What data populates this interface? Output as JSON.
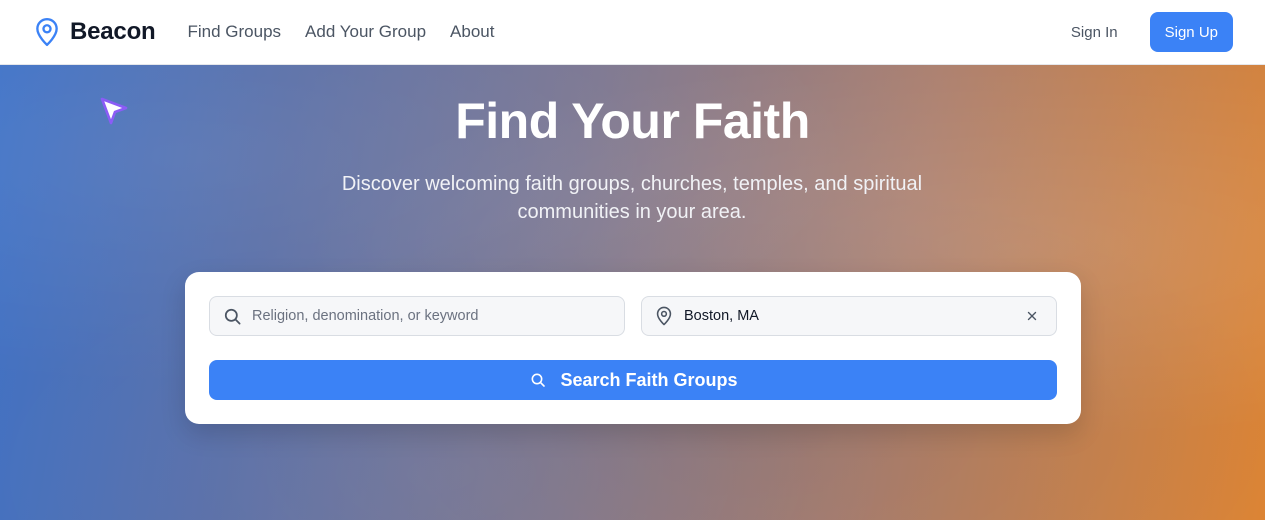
{
  "nav": {
    "brand": "Beacon",
    "links": [
      "Find Groups",
      "Add Your Group",
      "About"
    ],
    "sign_in": "Sign In",
    "sign_up": "Sign Up"
  },
  "hero": {
    "title": "Find Your Faith",
    "subtitle": "Discover welcoming faith groups, churches, temples, and spiritual communities in your area."
  },
  "search": {
    "keyword_placeholder": "Religion, denomination, or keyword",
    "keyword_value": "",
    "location_value": "Boston, MA",
    "button_label": "Search Faith Groups"
  },
  "colors": {
    "accent": "#3b82f6",
    "cursor_accent": "#8b5cf6"
  },
  "icons": {
    "brand": "map-pin-icon",
    "keyword": "search-icon",
    "location": "map-pin-icon",
    "clear": "close-icon",
    "button": "search-icon",
    "pointer": "pointer-cursor-icon"
  }
}
